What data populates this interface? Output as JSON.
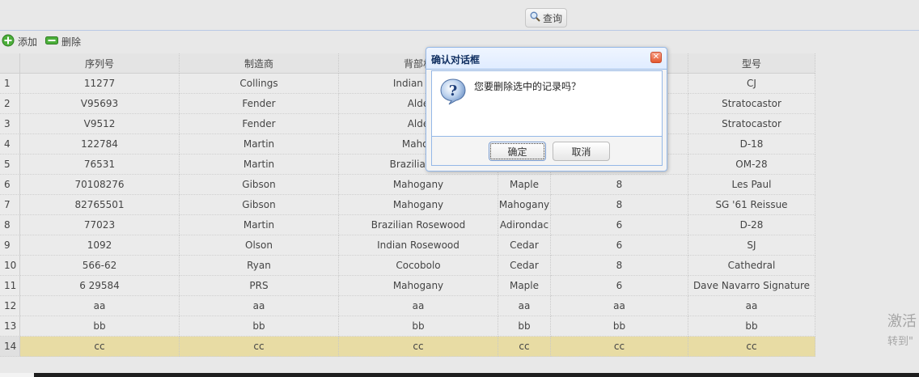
{
  "toolbar_top": {
    "query_label": "查询"
  },
  "toolbar": {
    "add_label": "添加",
    "delete_label": "删除"
  },
  "grid": {
    "columns": [
      "序列号",
      "制造商",
      "背部材",
      "",
      "",
      "型号"
    ],
    "rows": [
      {
        "n": "1",
        "cells": [
          "11277",
          "Collings",
          "Indian Ros",
          "",
          "",
          "CJ"
        ]
      },
      {
        "n": "2",
        "cells": [
          "V95693",
          "Fender",
          "Alde",
          "",
          "",
          "Stratocastor"
        ]
      },
      {
        "n": "3",
        "cells": [
          "V9512",
          "Fender",
          "Alde",
          "",
          "",
          "Stratocastor"
        ]
      },
      {
        "n": "4",
        "cells": [
          "122784",
          "Martin",
          "Mahog",
          "",
          "",
          "D-18"
        ]
      },
      {
        "n": "5",
        "cells": [
          "76531",
          "Martin",
          "Brazilian Ro",
          "",
          "",
          "OM-28"
        ]
      },
      {
        "n": "6",
        "cells": [
          "70108276",
          "Gibson",
          "Mahogany",
          "Maple",
          "8",
          "Les Paul"
        ]
      },
      {
        "n": "7",
        "cells": [
          "82765501",
          "Gibson",
          "Mahogany",
          "Mahogany",
          "8",
          "SG '61 Reissue"
        ]
      },
      {
        "n": "8",
        "cells": [
          "77023",
          "Martin",
          "Brazilian Rosewood",
          "Adirondac",
          "6",
          "D-28"
        ]
      },
      {
        "n": "9",
        "cells": [
          "1092",
          "Olson",
          "Indian Rosewood",
          "Cedar",
          "6",
          "SJ"
        ]
      },
      {
        "n": "10",
        "cells": [
          "566-62",
          "Ryan",
          "Cocobolo",
          "Cedar",
          "8",
          "Cathedral"
        ]
      },
      {
        "n": "11",
        "cells": [
          "6 29584",
          "PRS",
          "Mahogany",
          "Maple",
          "6",
          "Dave Navarro Signature"
        ]
      },
      {
        "n": "12",
        "cells": [
          "aa",
          "aa",
          "aa",
          "aa",
          "aa",
          "aa"
        ]
      },
      {
        "n": "13",
        "cells": [
          "bb",
          "bb",
          "bb",
          "bb",
          "bb",
          "bb"
        ]
      },
      {
        "n": "14",
        "cells": [
          "cc",
          "cc",
          "cc",
          "cc",
          "cc",
          "cc"
        ],
        "selected": true
      }
    ]
  },
  "dialog": {
    "title": "确认对话框",
    "message": "您要删除选中的记录吗？",
    "ok_label": "确定",
    "cancel_label": "取消"
  },
  "watermark": {
    "line1": "激活",
    "line2": "转到\""
  },
  "colors": {
    "selected_row": "#e8dca4",
    "dialog_border": "#95b8e7",
    "close_button": "#e4572e"
  },
  "icons": [
    "search-icon",
    "add-icon",
    "delete-icon",
    "question-icon",
    "close-icon"
  ]
}
